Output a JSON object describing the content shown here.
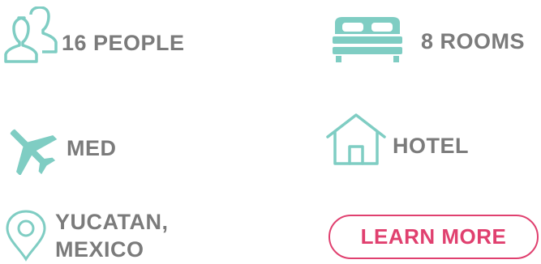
{
  "colors": {
    "icon": "#7fcdc3",
    "text": "#7b7b7b",
    "accent": "#e0406f"
  },
  "features": {
    "people": {
      "icon": "people-icon",
      "label": "16 PEOPLE"
    },
    "rooms": {
      "icon": "bed-icon",
      "label": "8 ROOMS"
    },
    "flight": {
      "icon": "airplane-icon",
      "label": "MED"
    },
    "lodging": {
      "icon": "house-icon",
      "label": "HOTEL"
    },
    "location": {
      "icon": "map-pin-icon",
      "line1": "YUCATAN,",
      "line2": "MEXICO"
    }
  },
  "cta": {
    "label": "LEARN MORE"
  }
}
